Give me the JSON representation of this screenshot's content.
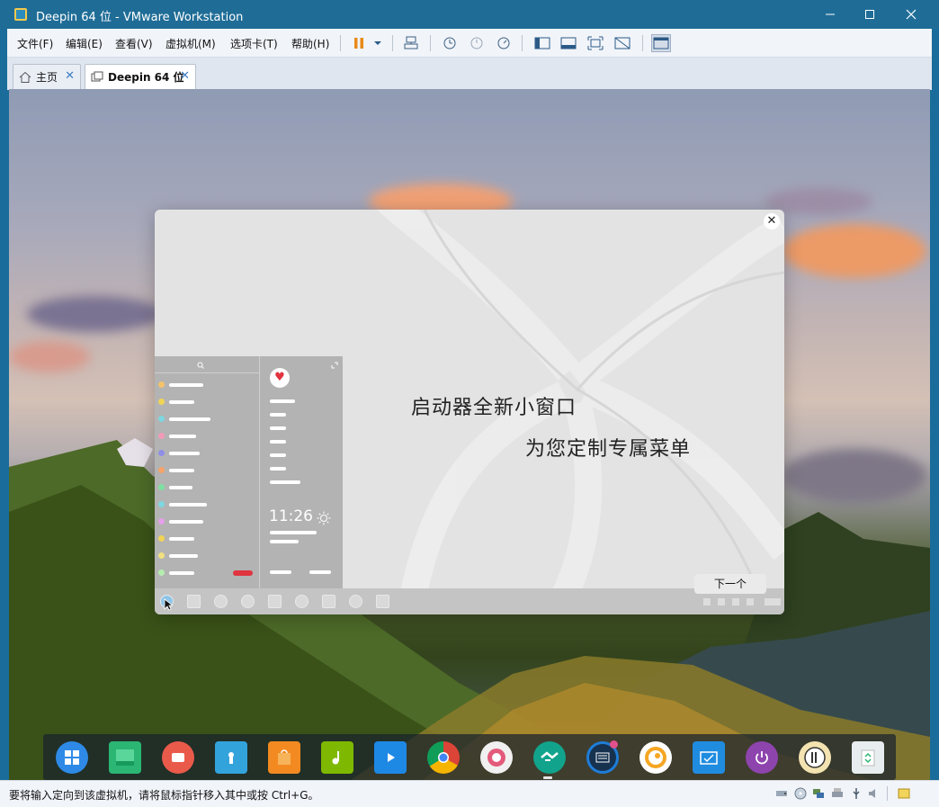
{
  "window": {
    "title": "Deepin 64 位 - VMware Workstation"
  },
  "menubar": {
    "items": [
      "文件(F)",
      "编辑(E)",
      "查看(V)",
      "虚拟机(M)",
      "选项卡(T)",
      "帮助(H)"
    ]
  },
  "tabs": [
    {
      "label": "主页",
      "icon": "home-icon"
    },
    {
      "label": "Deepin 64 位",
      "icon": "vm-icon",
      "active": true
    }
  ],
  "dialog": {
    "headline": "启动器全新小窗口",
    "subline": "为您定制专属菜单",
    "next_label": "下一个",
    "close_glyph": "✕",
    "preview_clock": "11:26",
    "preview_icons": [
      "search-icon",
      "expand-icon",
      "heart-icon",
      "sun-icon"
    ]
  },
  "dock": {
    "items": [
      {
        "name": "launcher",
        "icon": "launcher-icon",
        "color": "#2e8ae6"
      },
      {
        "name": "terminal",
        "icon": "terminal-icon",
        "color": "#2bb673"
      },
      {
        "name": "screen-recorder",
        "icon": "screen-recorder-icon",
        "color": "#ea5a4b"
      },
      {
        "name": "file-manager",
        "icon": "folder-icon",
        "color": "#33a3dc"
      },
      {
        "name": "app-store",
        "icon": "store-icon",
        "color": "#f28a21"
      },
      {
        "name": "music",
        "icon": "music-icon",
        "color": "#7fb800"
      },
      {
        "name": "movie",
        "icon": "movie-icon",
        "color": "#1e88e5"
      },
      {
        "name": "chrome",
        "icon": "chrome-icon",
        "color": "#db4437"
      },
      {
        "name": "settings",
        "icon": "settings-icon",
        "color": "#e35a7a"
      },
      {
        "name": "help",
        "icon": "handshake-icon",
        "color": "#12a38c"
      },
      {
        "name": "screenshot",
        "icon": "screenshot-icon",
        "color": "#1f7dd8"
      },
      {
        "name": "media-player",
        "icon": "media-player-icon",
        "color": "#f5a623"
      },
      {
        "name": "remote-assistance",
        "icon": "remote-assistance-icon",
        "color": "#1f8ce0"
      },
      {
        "name": "shutdown",
        "icon": "power-icon",
        "color": "#8e44ad"
      },
      {
        "name": "calendar",
        "icon": "calendar-icon",
        "color": "#f3e3b1"
      },
      {
        "name": "trash",
        "icon": "trash-icon",
        "color": "#e8eef0"
      }
    ],
    "active_app": "help"
  },
  "statusbar": {
    "message": "要将输入定向到该虚拟机，请将鼠标指针移入其中或按 Ctrl+G。"
  },
  "colors": {
    "titlebar": "#1f6d97",
    "accent": "#3d7fc6",
    "heart_red": "#e0343f"
  }
}
